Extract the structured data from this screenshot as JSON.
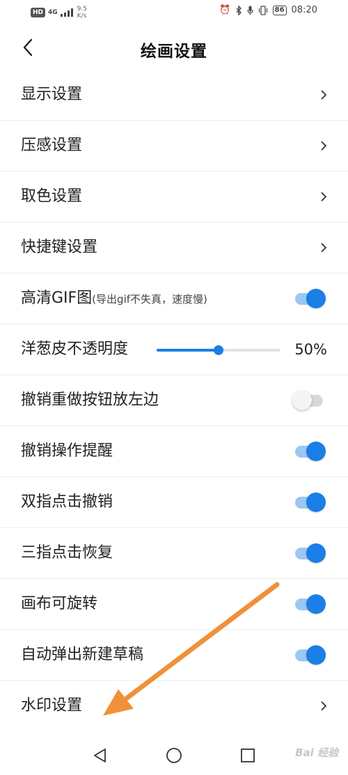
{
  "status_bar": {
    "hd": "HD",
    "network": "4G",
    "speed_value": "9.5",
    "speed_unit": "K/s",
    "battery": "86",
    "time": "08:20"
  },
  "header": {
    "title": "绘画设置"
  },
  "settings": {
    "display": {
      "label": "显示设置"
    },
    "pressure": {
      "label": "压感设置"
    },
    "color_pick": {
      "label": "取色设置"
    },
    "shortcut": {
      "label": "快捷键设置"
    },
    "hd_gif": {
      "label": "高清GIF图",
      "note": "(导出gif不失真，速度慢)",
      "enabled": true
    },
    "onion": {
      "label": "洋葱皮不透明度",
      "value_percent": 50,
      "value_text": "50%"
    },
    "undo_left": {
      "label": "撤销重做按钮放左边",
      "enabled": false
    },
    "undo_remind": {
      "label": "撤销操作提醒",
      "enabled": true
    },
    "two_finger": {
      "label": "双指点击撤销",
      "enabled": true
    },
    "three_finger": {
      "label": "三指点击恢复",
      "enabled": true
    },
    "rotate": {
      "label": "画布可旋转",
      "enabled": true
    },
    "auto_draft": {
      "label": "自动弹出新建草稿",
      "enabled": true
    },
    "watermark": {
      "label": "水印设置"
    }
  },
  "nav_bar": {
    "back_icon": "triangle-back-icon",
    "home_icon": "circle-home-icon",
    "recents_icon": "square-recents-icon"
  },
  "watermark_text": "Bai 经验",
  "colors": {
    "accent": "#1a7fe6",
    "accent_track": "#9cc7f2",
    "annotation_arrow": "#f0903a"
  }
}
